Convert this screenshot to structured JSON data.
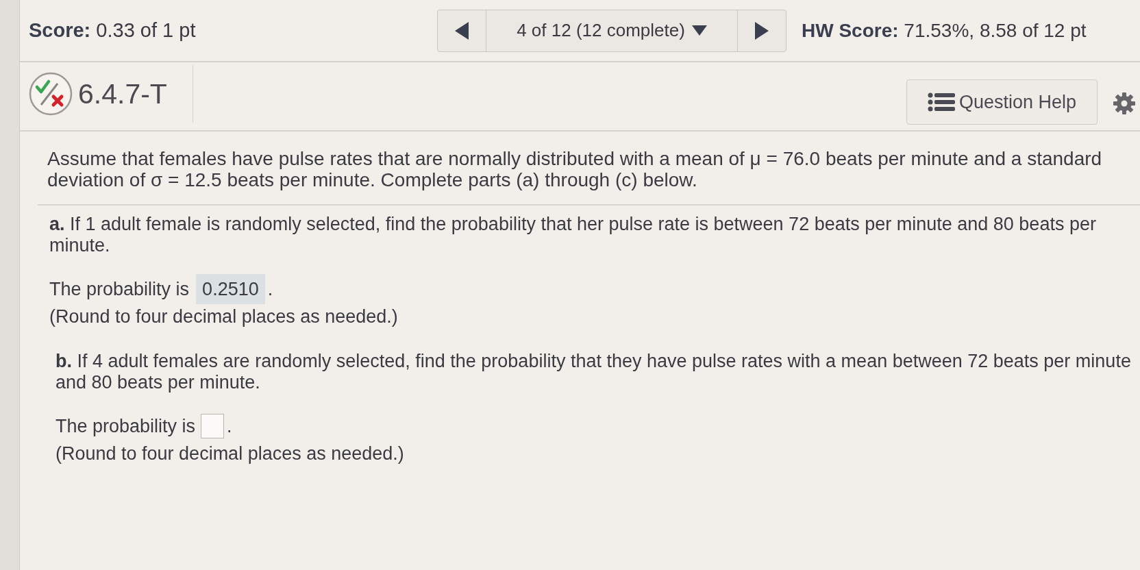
{
  "score_bar": {
    "score": "**Score:** 0.33 of 1 pt",
    "navigator": {
      "position": "4 of 12 (12 complete)"
    },
    "hw_score": "**HW Score:** 71.53%, 8.58 of 12 pt"
  },
  "question_header": {
    "status_icon": {
      "kind": "partial"
    },
    "number": "6.4.7-T",
    "help_button": "Question Help"
  },
  "problem": {
    "statement": "Assume that females have pulse rates that are normally distributed with a mean of μ = 76.0 beats per minute and a standard deviation of σ = 12.5 beats per minute. Complete parts (a) through (c) below."
  },
  "parts": [
    {
      "text": "**a.** If 1 adult female is randomly selected, find the probability that her pulse rate is between 72 beats per minute and 80 beats per minute.",
      "prompt": "The probability is",
      "answer": {
        "kind": "filled",
        "value": "0.2510"
      },
      "suffix": ".",
      "hint": "(Round to four decimal places as needed.)"
    },
    {
      "text": "**b.** If 4 adult females are randomly selected, find the probability that they have pulse rates with a mean between 72 beats per minute and 80 beats per minute.",
      "prompt": "The probability is",
      "answer": {
        "kind": "blank"
      },
      "suffix": ".",
      "hint": "(Round to four decimal places as needed.)"
    }
  ]
}
